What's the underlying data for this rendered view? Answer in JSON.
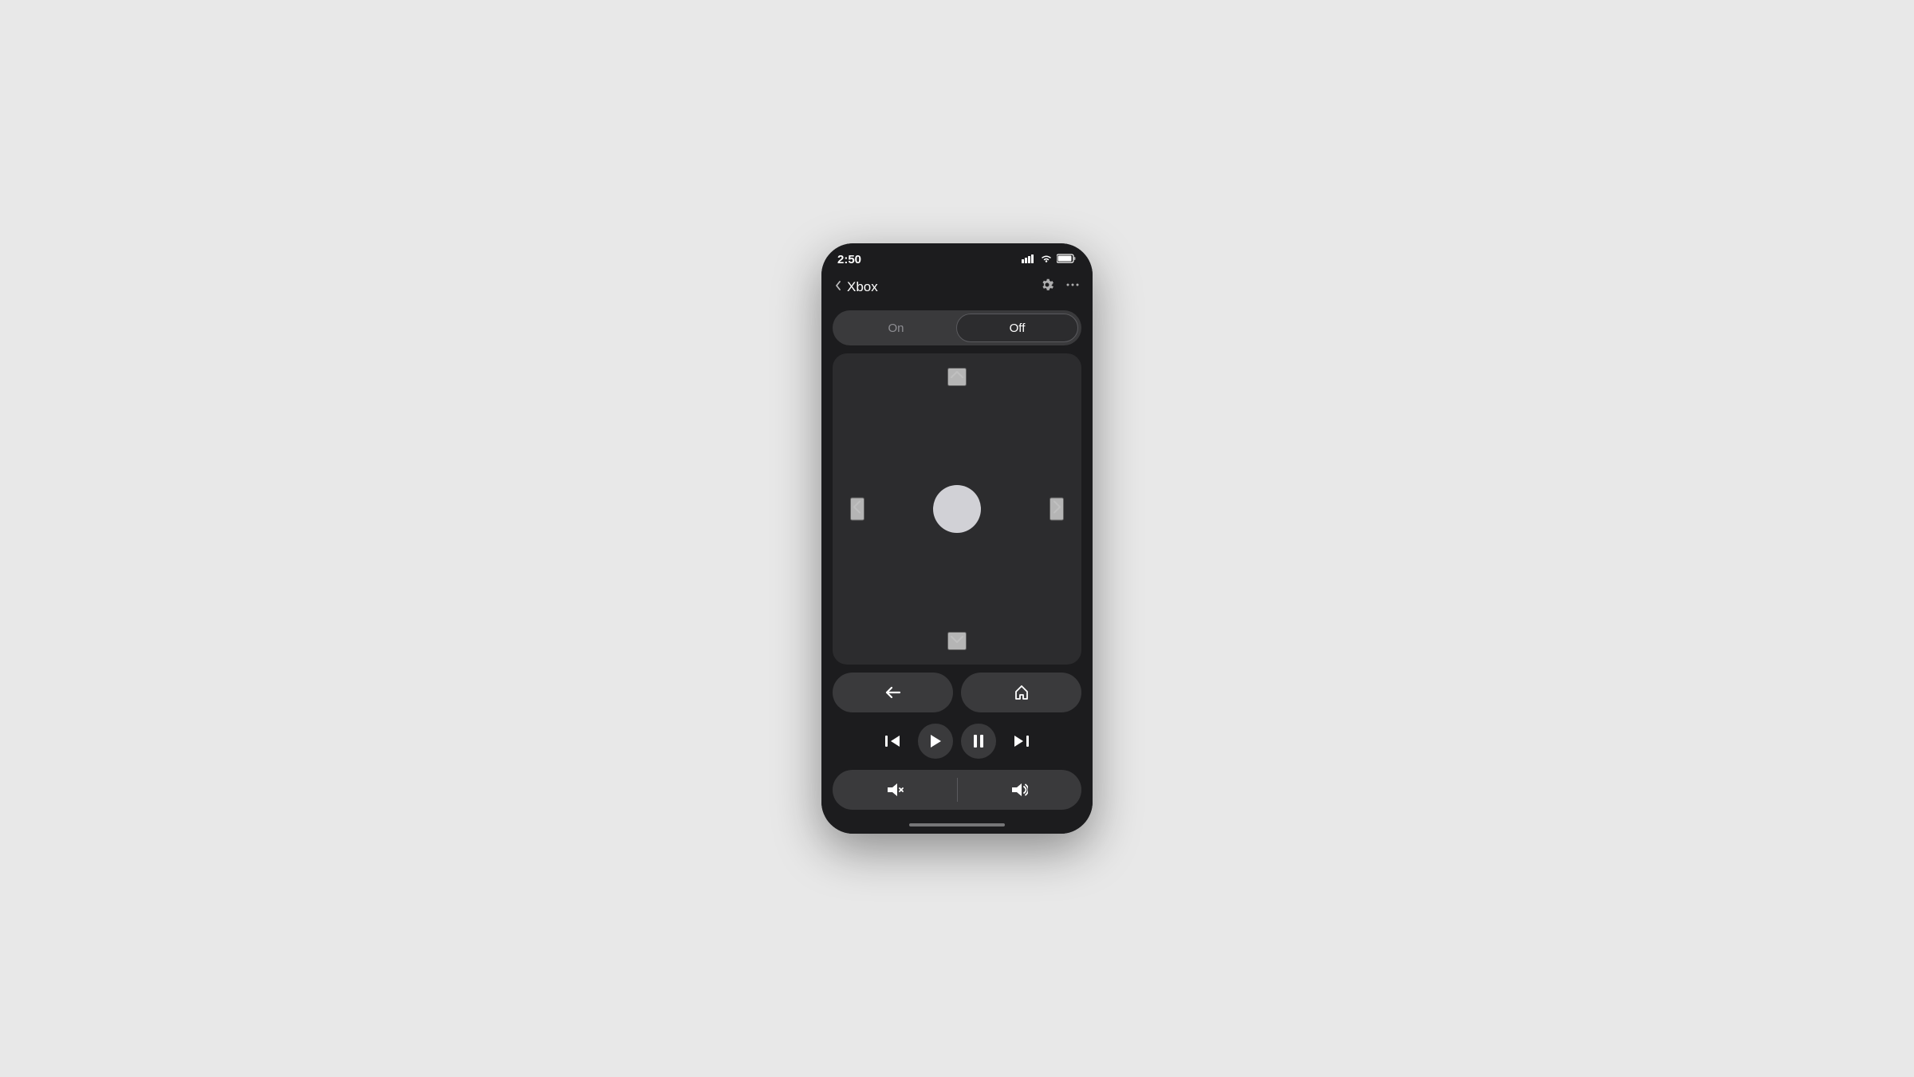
{
  "statusBar": {
    "time": "2:50",
    "signal": "▂▄▆█",
    "wifi": "wifi",
    "battery": "battery"
  },
  "header": {
    "backLabel": "‹",
    "title": "Xbox",
    "gearLabel": "⚙",
    "moreLabel": "···"
  },
  "toggle": {
    "onLabel": "On",
    "offLabel": "Off",
    "activeState": "off"
  },
  "dpad": {
    "upLabel": "^",
    "downLabel": "v",
    "leftLabel": "<",
    "rightLabel": ">"
  },
  "navButtons": {
    "backLabel": "←",
    "homeLabel": "⌂"
  },
  "mediaControls": {
    "prevLabel": "⏮",
    "playLabel": "▶",
    "pauseLabel": "⏸",
    "nextLabel": "⏭"
  },
  "volumeControls": {
    "downLabel": "🔈",
    "upLabel": "🔊"
  }
}
